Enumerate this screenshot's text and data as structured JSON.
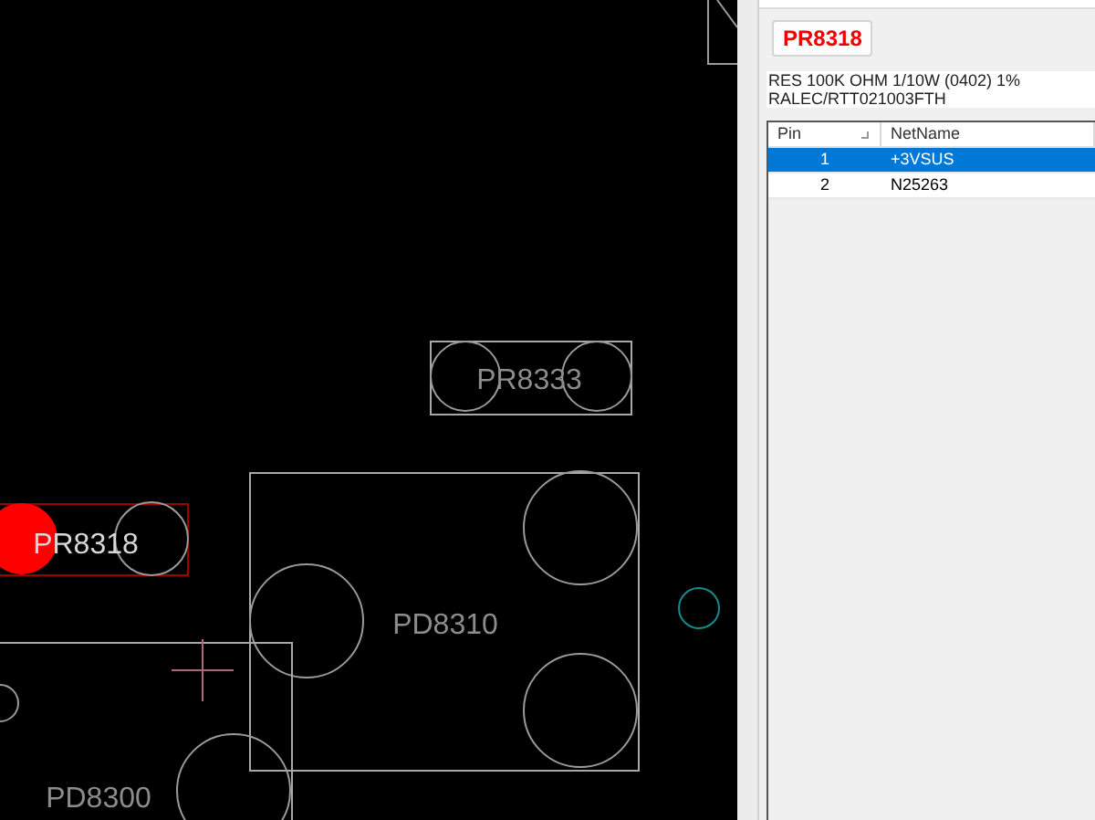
{
  "board": {
    "components": [
      {
        "label": "PR8333",
        "selected": false
      },
      {
        "label": "PR8318",
        "selected": true
      },
      {
        "label": "PD8310",
        "selected": false
      },
      {
        "label": "PD8300",
        "selected": false
      }
    ]
  },
  "panel": {
    "part_button": "PR8318",
    "description": [
      "RES 100K OHM 1/10W (0402) 1%",
      "RALEC/RTT021003FTH"
    ],
    "table": {
      "columns": [
        "Pin",
        "NetName"
      ],
      "rows": [
        {
          "cells": [
            "1",
            "+3VSUS"
          ],
          "selected": true
        },
        {
          "cells": [
            "2",
            "N25263"
          ],
          "selected": false
        }
      ]
    }
  }
}
